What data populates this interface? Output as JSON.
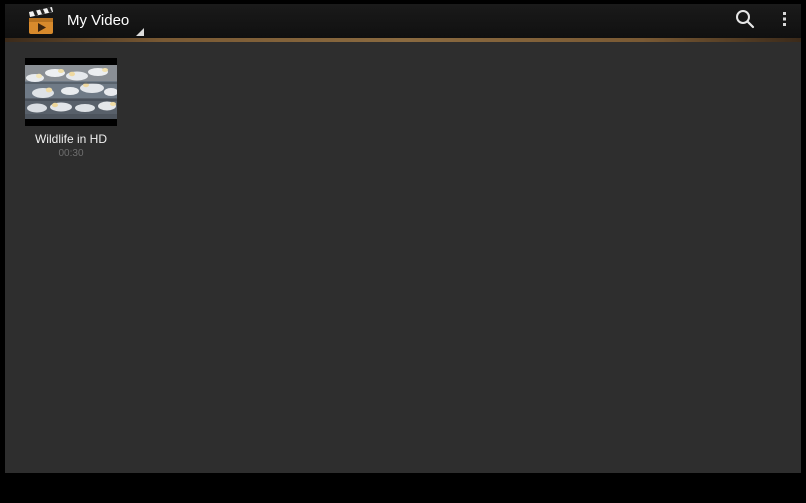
{
  "app": {
    "title": "My Video",
    "icon": "video-clapperboard-icon",
    "accent_color": "#8a6a40"
  },
  "actions": {
    "search_icon": "search-icon",
    "overflow_icon": "overflow-menu-icon"
  },
  "videos": [
    {
      "title": "Wildlife in HD",
      "duration": "00:30"
    }
  ]
}
